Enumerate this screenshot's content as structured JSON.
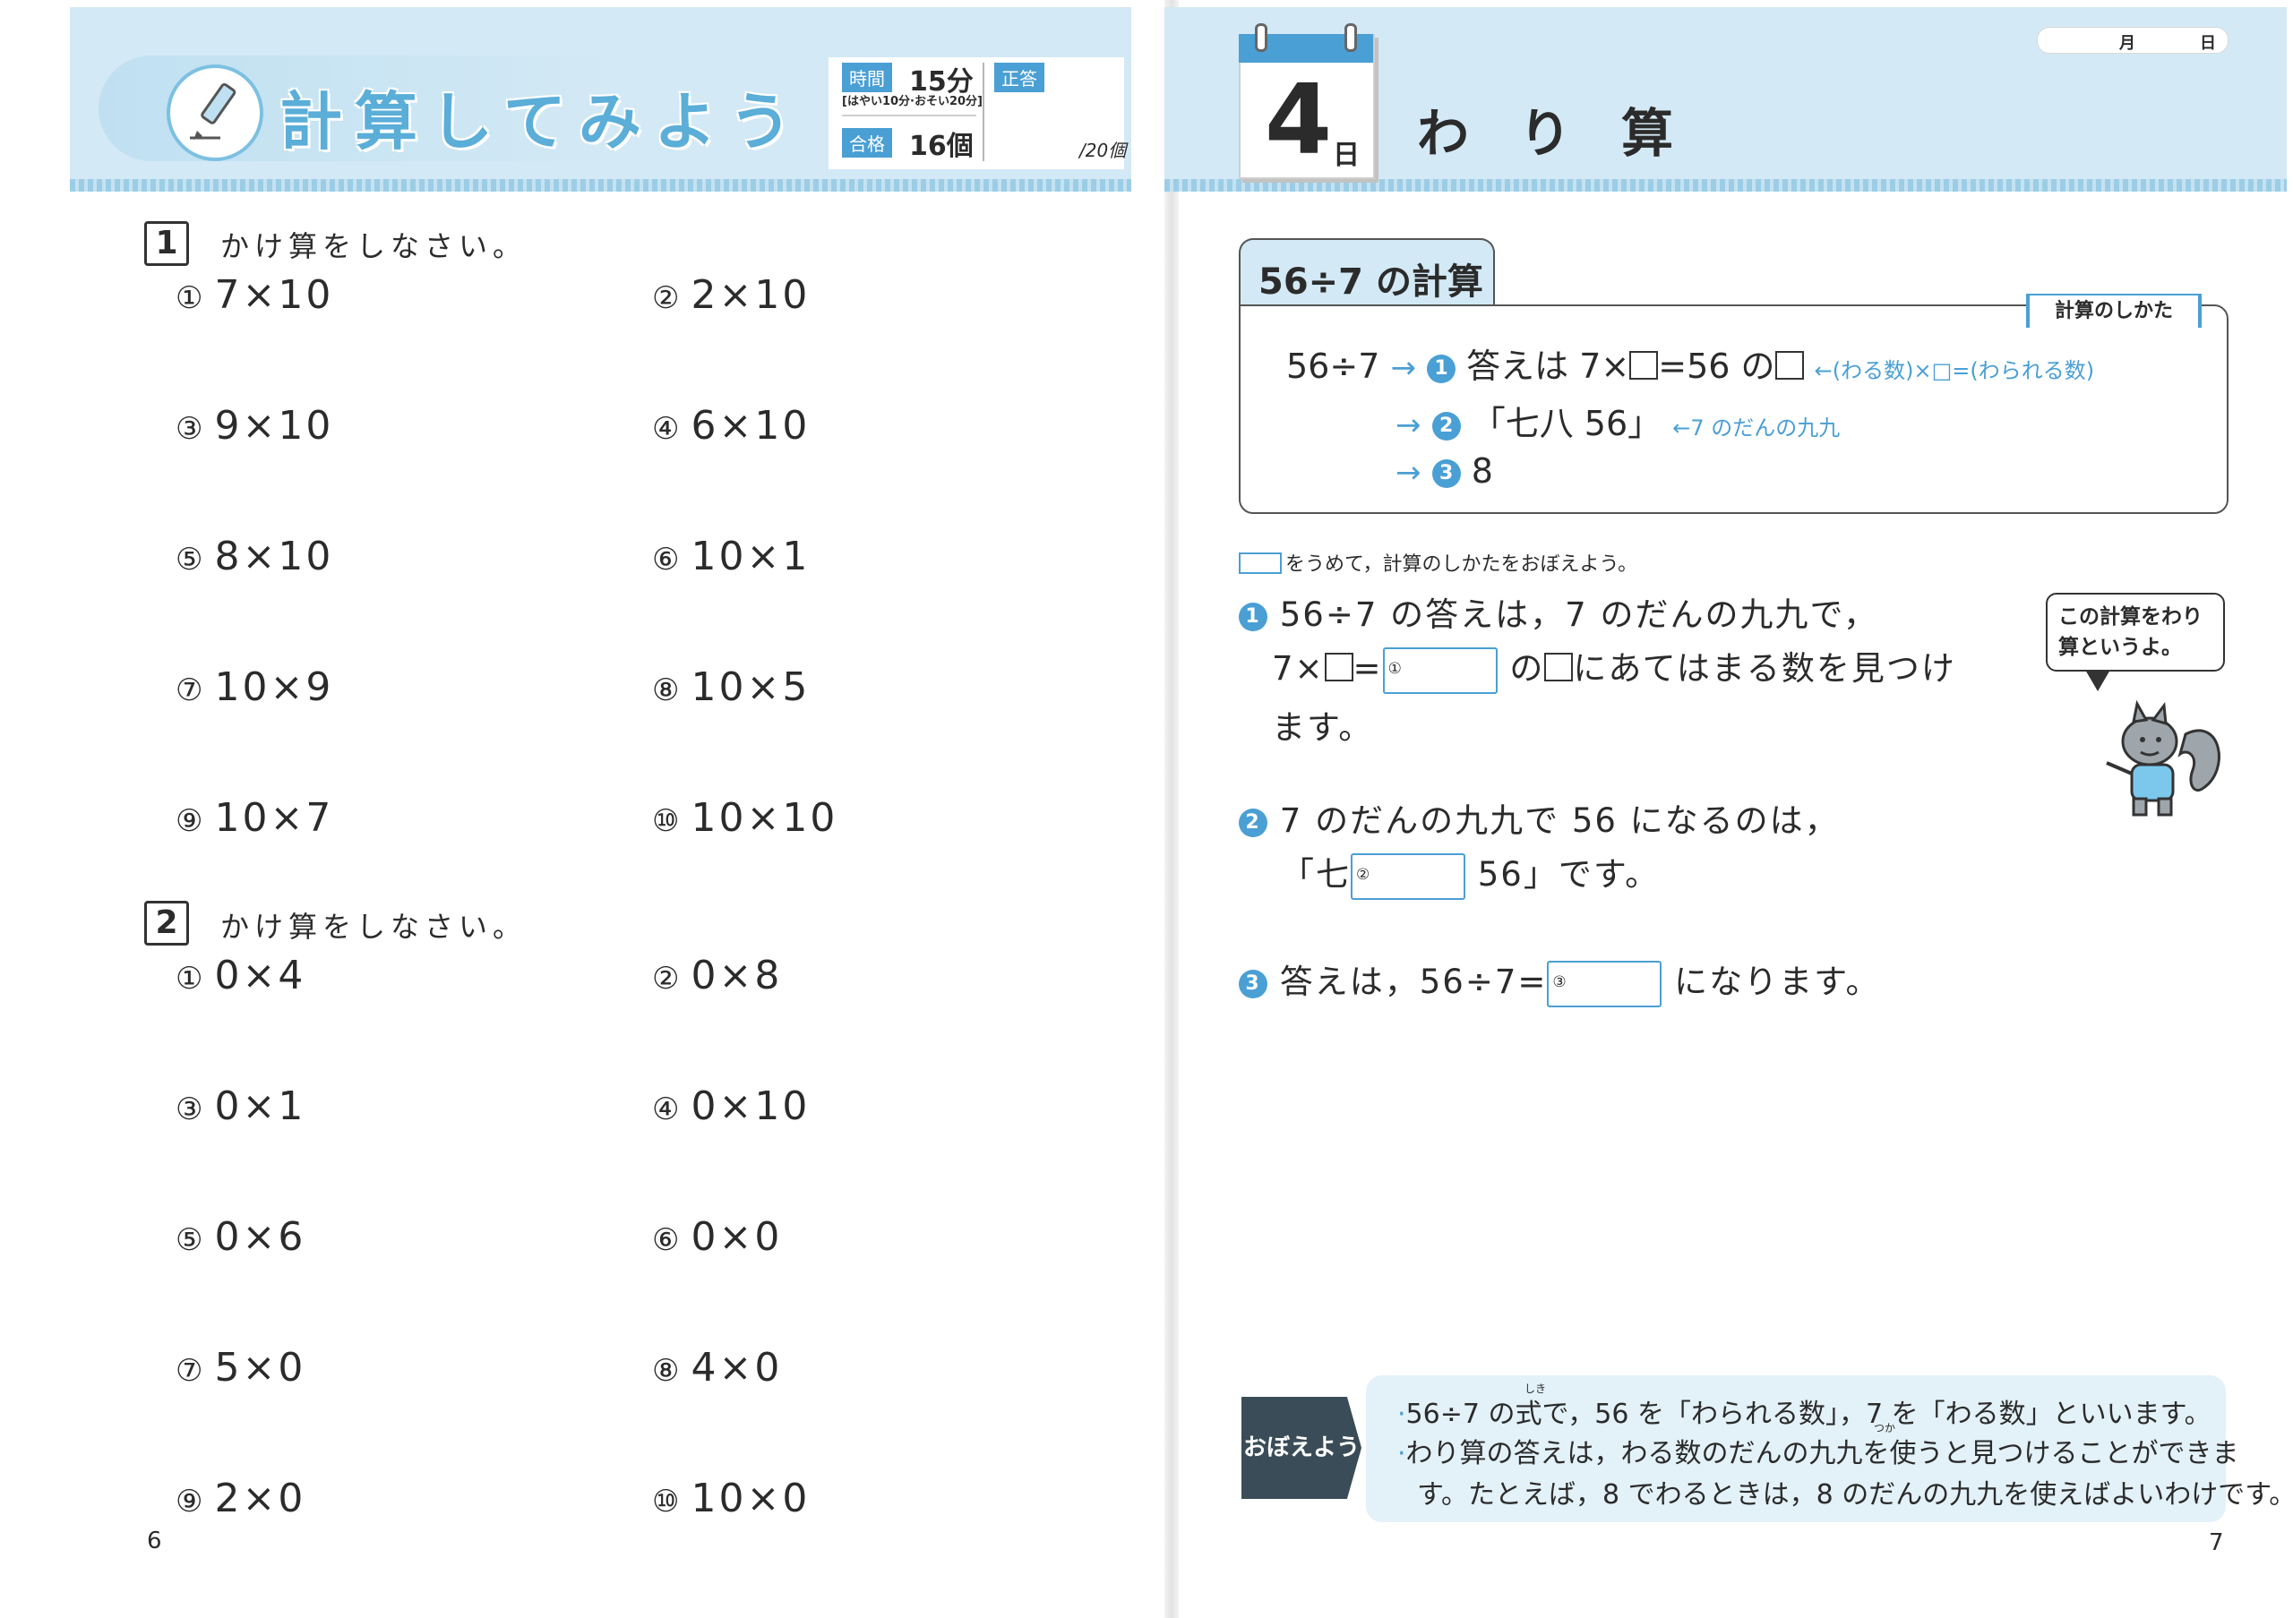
{
  "left_page": {
    "title": "計算してみよう",
    "time_label": "時間",
    "time_value": "15分",
    "time_note": "[はやい10分·おそい20分]",
    "pass_label": "合格",
    "pass_value": "16個",
    "correct_label": "正答",
    "total": "/20個",
    "page_number": "6",
    "section1": {
      "number": "1",
      "instruction": "かけ算をしなさい。",
      "problems": [
        {
          "num": "①",
          "expr": "7×10"
        },
        {
          "num": "②",
          "expr": "2×10"
        },
        {
          "num": "③",
          "expr": "9×10"
        },
        {
          "num": "④",
          "expr": "6×10"
        },
        {
          "num": "⑤",
          "expr": "8×10"
        },
        {
          "num": "⑥",
          "expr": "10×1"
        },
        {
          "num": "⑦",
          "expr": "10×9"
        },
        {
          "num": "⑧",
          "expr": "10×5"
        },
        {
          "num": "⑨",
          "expr": "10×7"
        },
        {
          "num": "⑩",
          "expr": "10×10"
        }
      ]
    },
    "section2": {
      "number": "2",
      "instruction": "かけ算をしなさい。",
      "problems": [
        {
          "num": "①",
          "expr": "0×4"
        },
        {
          "num": "②",
          "expr": "0×8"
        },
        {
          "num": "③",
          "expr": "0×1"
        },
        {
          "num": "④",
          "expr": "0×10"
        },
        {
          "num": "⑤",
          "expr": "0×6"
        },
        {
          "num": "⑥",
          "expr": "0×0"
        },
        {
          "num": "⑦",
          "expr": "5×0"
        },
        {
          "num": "⑧",
          "expr": "4×0"
        },
        {
          "num": "⑨",
          "expr": "2×0"
        },
        {
          "num": "⑩",
          "expr": "10×0"
        }
      ]
    }
  },
  "right_page": {
    "day_number": "4",
    "day_unit": "日",
    "title": "わり算",
    "date_month": "月",
    "date_day": "日",
    "page_number": "7",
    "example": {
      "tab": "56÷7 の計算",
      "method_label": "計算のしかた",
      "line1_expr": "56÷7",
      "step1_marker": "1",
      "step1_text": "答えは 7×",
      "step1_text_b": "=56 の",
      "step1_note": "←(わる数)×□=(わられる数)",
      "step2_marker": "2",
      "step2_text": "「七八 56」",
      "step2_note": "←7 のだんの九九",
      "step3_marker": "3",
      "step3_text": "8"
    },
    "instruction": "をうめて，計算のしかたをおぼえよう。",
    "q1": {
      "marker": "1",
      "line1": "56÷7 の答えは，7 のだんの九九で，",
      "line2_a": "7×",
      "line2_b": "=",
      "box": "①",
      "line2_c": "の",
      "line2_d": "にあてはまる数を見つけ",
      "line3": "ます。"
    },
    "q2": {
      "marker": "2",
      "line1": "7 のだんの九九で 56 になるのは，",
      "line2_a": "「七",
      "box": "②",
      "line2_b": "56」です。"
    },
    "q3": {
      "marker": "3",
      "line_a": "答えは，56÷7=",
      "box": "③",
      "line_b": "になります。"
    },
    "bubble": {
      "line1": "この計算をわり",
      "line2": "算というよ。"
    },
    "memo": {
      "tag": "おぼえよう",
      "line1": "56÷7 の式で，56 を「わられる数」，7 を「わる数」といいます。",
      "ruby1": "しき",
      "line2": "わり算の答えは，わる数のだんの九九を使うと見つけることができま",
      "ruby2": "つか",
      "line3": "す。たとえば，8 でわるときは，8 のだんの九九を使えばよいわけです。"
    }
  }
}
